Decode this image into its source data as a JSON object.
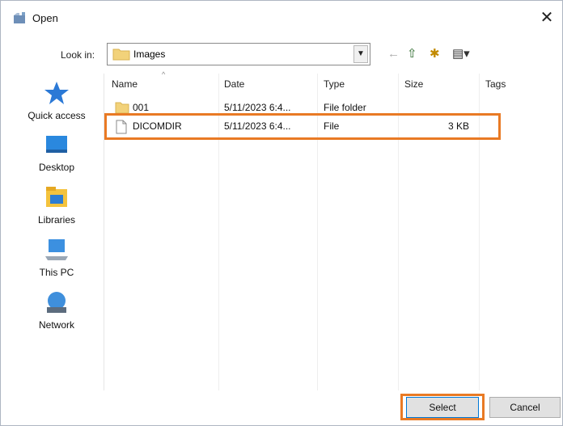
{
  "window": {
    "title": "Open",
    "close_glyph": "✕"
  },
  "lookin": {
    "label": "Look in:",
    "value": "Images",
    "arrow": "▼"
  },
  "toolbar": {
    "back_glyph": "←",
    "up_glyph": "⇧",
    "newfolder_glyph": "✱",
    "view_glyph": "▤▾"
  },
  "places": [
    {
      "label": "Quick access",
      "icon": "star-icon"
    },
    {
      "label": "Desktop",
      "icon": "desktop-icon"
    },
    {
      "label": "Libraries",
      "icon": "libraries-icon"
    },
    {
      "label": "This PC",
      "icon": "computer-icon"
    },
    {
      "label": "Network",
      "icon": "network-icon"
    }
  ],
  "columns": {
    "name": "Name",
    "date": "Date",
    "type": "Type",
    "size": "Size",
    "tags": "Tags",
    "sort_caret": "^"
  },
  "files": [
    {
      "name": "001",
      "date": "5/11/2023 6:4...",
      "type": "File folder",
      "size": "",
      "icon": "folder-icon"
    },
    {
      "name": "DICOMDIR",
      "date": "5/11/2023 6:4...",
      "type": "File",
      "size": "3 KB",
      "icon": "file-icon"
    }
  ],
  "buttons": {
    "select": "Select",
    "cancel": "Cancel"
  },
  "colors": {
    "highlight": "#e97a24",
    "accent": "#0078d7"
  }
}
